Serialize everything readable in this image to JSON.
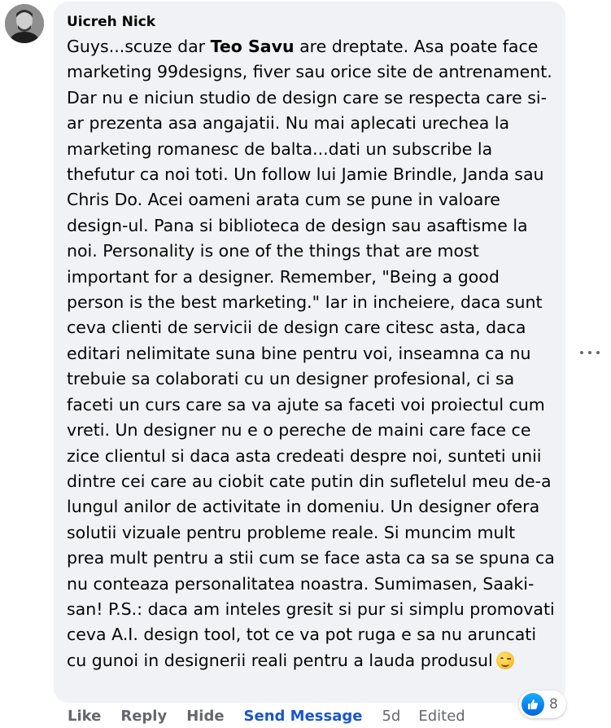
{
  "comment": {
    "author": "Uicreh Nick",
    "mention": "Teo Savu",
    "text_before_mention": "Guys...scuze dar ",
    "text_after_mention": " are dreptate. Asa poate face marketing 99designs, fiver sau orice site de antrenament. Dar nu e niciun studio de design care se respecta care si-ar prezenta asa angajatii. Nu mai aplecati urechea la marketing romanesc de balta...dati un subscribe la thefutur ca noi toti. Un follow lui Jamie Brindle, Janda sau Chris Do. Acei oameni arata cum se pune in valoare design-ul. Pana si biblioteca de design sau asaftisme la noi. Personality is one of the things that are most important for a designer. Remember, \"Being a good person is the best marketing.\" Iar in incheiere, daca sunt ceva clienti de servicii de design care citesc asta, daca editari nelimitate suna bine pentru voi, inseamna ca nu trebuie sa colaborati cu un designer profesional, ci sa faceti un curs care sa va ajute sa faceti voi proiectul cum vreti. Un designer nu e o pereche de maini care face ce zice clientul si daca asta credeati despre noi, sunteti unii dintre cei care au ciobit cate putin din sufletelul meu de-a lungul anilor de activitate in domeniu. Un designer ofera solutii vizuale pentru probleme reale. Si muncim mult prea mult pentru a stii cum se face asta ca sa se spuna ca nu conteaza personalitatea noastra. Sumimasen, Saaki-san! P.S.: daca am inteles gresit si pur si simplu promovati ceva A.I. design tool, tot ce va pot ruga e sa nu aruncati cu gunoi in designerii reali pentru a lauda produsul",
    "emoji_icon": "winking-face-emoji",
    "avatar_icon": "user-avatar",
    "more_icon": "more-options-icon"
  },
  "reactions": {
    "icon": "like-reaction-icon",
    "count": "8"
  },
  "actions": {
    "like": "Like",
    "reply": "Reply",
    "hide": "Hide",
    "send_message": "Send Message",
    "timestamp": "5d",
    "edited": "Edited"
  },
  "colors": {
    "bubble": "#f0f2f5",
    "action_text": "#65676b",
    "send_message": "#1a55c9",
    "like_badge": "#0866ff"
  }
}
